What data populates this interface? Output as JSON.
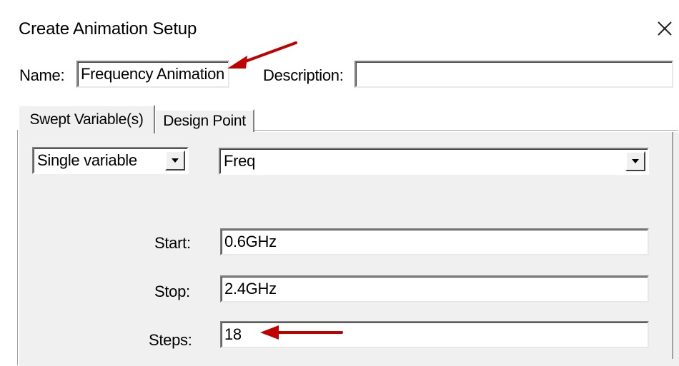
{
  "dialog": {
    "title": "Create Animation Setup",
    "close_glyph": "✕",
    "close_icon": "close-icon"
  },
  "header": {
    "name_label": "Name:",
    "name_value": "Frequency Animation",
    "description_label": "Description:",
    "description_value": ""
  },
  "tabs": [
    {
      "label": "Swept Variable(s)",
      "active": true
    },
    {
      "label": "Design Point",
      "active": false
    }
  ],
  "swept": {
    "mode_value": "Single variable",
    "variable_value": "Freq",
    "start_label": "Start:",
    "start_value": "0.6GHz",
    "stop_label": "Stop:",
    "stop_value": "2.4GHz",
    "steps_label": "Steps:",
    "steps_value": "18"
  },
  "annotations": {
    "arrow_color": "#c00000",
    "arrows": [
      "arrow-to-name-field",
      "arrow-to-steps-field"
    ]
  }
}
